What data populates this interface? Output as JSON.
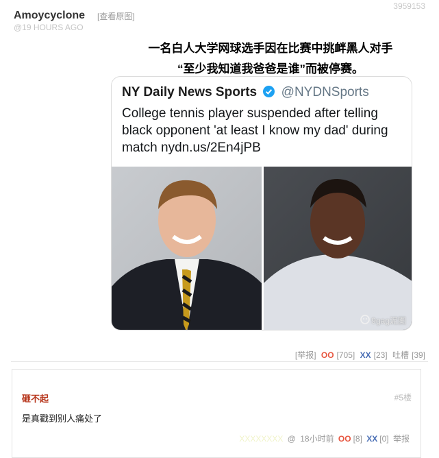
{
  "post": {
    "id": "3959153",
    "author": "Amoycyclone",
    "view_original": "[查看原图]",
    "time": "@19 HOURS AGO",
    "caption_lines": [
      "一名白人大学网球选手因在比赛中挑衅黑人对手",
      "“至少我知道我爸爸是谁”而被停赛。"
    ],
    "tweet": {
      "name": "NY Daily News Sports",
      "handle": "@NYDNSports",
      "text": "College tennis player suspended after telling black opponent 'at least I know my dad' during match nydn.us/2En4jPB",
      "watermark": "9gag泥图"
    },
    "actions": {
      "report": "[举报]",
      "oo_label": "OO",
      "oo_count": "[705]",
      "xx_label": "XX",
      "xx_count": "[23]",
      "tucao_label": "吐槽",
      "tucao_count": "[39]"
    }
  },
  "comment": {
    "author": "砸不起",
    "floor": "#5楼",
    "text": "是真戳到别人痛处了",
    "meta": {
      "faded_name": "XXXXXXXX",
      "at": "@",
      "time": "18小时前",
      "oo_label": "OO",
      "oo_count": "[8]",
      "xx_label": "XX",
      "xx_count": "[0]",
      "report": "举报"
    }
  },
  "colors": {
    "oo": "#e7553f",
    "xx": "#4a6fb5",
    "comment_author": "#b7361c",
    "verified": "#1da1f2"
  }
}
